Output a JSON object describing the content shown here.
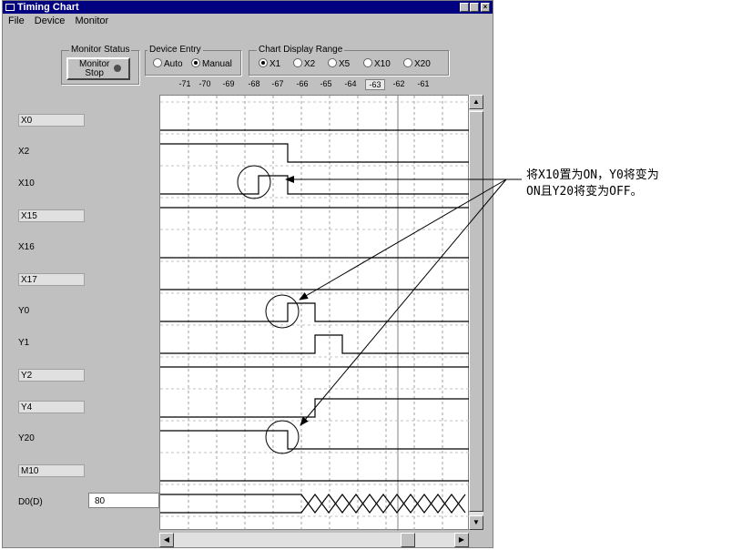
{
  "window": {
    "title": "Timing Chart"
  },
  "menu": [
    {
      "label": "File"
    },
    {
      "label": "Device"
    },
    {
      "label": "Monitor"
    }
  ],
  "monitor_status": {
    "group_label": "Monitor Status",
    "button_line1": "Monitor",
    "button_line2": "Stop"
  },
  "device_entry": {
    "group_label": "Device Entry",
    "auto": "Auto",
    "manual": "Manual",
    "selected": "Manual"
  },
  "display_range": {
    "group_label": "Chart Display Range",
    "options": [
      "X1",
      "X2",
      "X5",
      "X10",
      "X20"
    ],
    "selected": "X1"
  },
  "ticks": [
    "-71",
    "-70",
    "-69",
    "-68",
    "-67",
    "-66",
    "-65",
    "-64",
    "-63",
    "-62",
    "-61"
  ],
  "current_tick": "-63",
  "devices": [
    {
      "label": "X0"
    },
    {
      "label": "X2"
    },
    {
      "label": "X10"
    },
    {
      "label": "X15"
    },
    {
      "label": "X16"
    },
    {
      "label": "X17"
    },
    {
      "label": "Y0"
    },
    {
      "label": "Y1"
    },
    {
      "label": "Y2"
    },
    {
      "label": "Y4"
    },
    {
      "label": "Y20"
    },
    {
      "label": "M10"
    },
    {
      "label": "D0(D)"
    }
  ],
  "d0_value": "80",
  "annotation": {
    "line1": "将X10置为ON，Y0将变为",
    "line2": "ON且Y20将变为OFF。"
  },
  "colors": {
    "titlebar": "#000080",
    "face": "#c0c0c0"
  }
}
